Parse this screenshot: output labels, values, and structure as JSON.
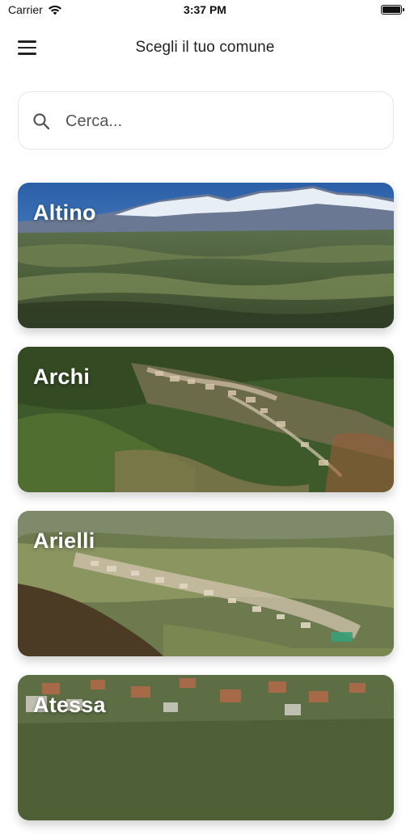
{
  "status_bar": {
    "carrier": "Carrier",
    "time": "3:37 PM",
    "battery_level": 1.0,
    "wifi_icon": "wifi-icon",
    "battery_icon": "battery-icon"
  },
  "header": {
    "title": "Scegli il tuo comune",
    "menu_icon": "hamburger-menu-icon"
  },
  "search": {
    "placeholder": "Cerca...",
    "value": "",
    "icon": "search-icon"
  },
  "municipalities": [
    {
      "name": "Altino"
    },
    {
      "name": "Archi"
    },
    {
      "name": "Arielli"
    },
    {
      "name": "Atessa"
    }
  ],
  "colors": {
    "background": "#ffffff",
    "card_title": "#ffffff",
    "search_border": "#e6e6e6"
  }
}
